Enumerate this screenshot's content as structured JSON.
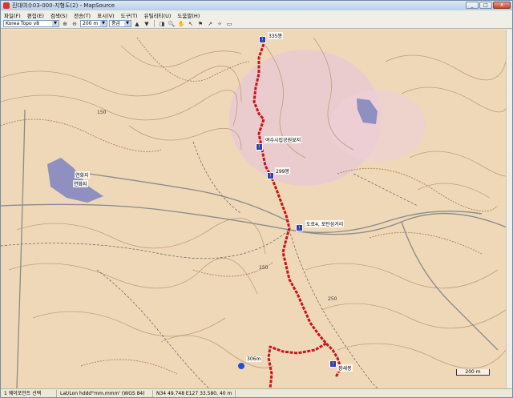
{
  "window": {
    "title": "진대여수03-000-지형도(2) - MapSource",
    "controls": [
      "_",
      "□",
      "X"
    ]
  },
  "menu": [
    "파일(F)",
    "편집(E)",
    "검색(S)",
    "전송(T)",
    "표시(V)",
    "도구(T)",
    "유틸리티(U)",
    "도움말(H)"
  ],
  "toolbar": {
    "product": "Korea Topo v8",
    "scale": "200 m",
    "detail": "중급"
  },
  "map": {
    "labels": {
      "peak_top": "335봉",
      "cemetery": "여수시립공원묘지",
      "peak_299": "299봉",
      "junction": "도로4, 포탄삼거리",
      "hwasanbong": "장새봉",
      "peak_306": "306m",
      "reservoir1": "연화지",
      "reservoir2": "연화지",
      "elev_250": "250",
      "elev_150a": "150",
      "elev_150b": "150",
      "scale": "200 m"
    }
  },
  "status": {
    "selection": "1 웨이포인트 선택",
    "format": "Lat/Lon hddd°mm.mmm' (WGS 84)",
    "coords": "N34 49.748 E127 33.580, 40 m"
  }
}
